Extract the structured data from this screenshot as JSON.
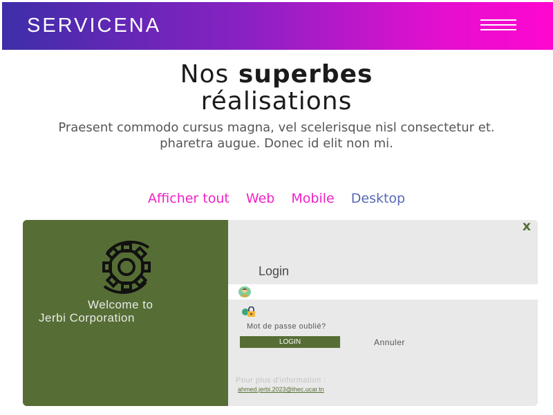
{
  "header": {
    "brand": "SERVICENA",
    "menu_icon": "hamburger-menu-icon"
  },
  "hero": {
    "title_light": "Nos",
    "title_bold": "superbes",
    "title_line2": "réalisations",
    "subtitle_line1": "Praesent commodo cursus magna, vel scelerisque nisl consectetur et.",
    "subtitle_line2": "pharetra augue. Donec id elit non mi."
  },
  "filters": {
    "items": [
      "Afficher tout",
      "Web",
      "Mobile",
      "Desktop"
    ]
  },
  "card": {
    "welcome_line1": "Welcome to",
    "welcome_line2": "Jerbi Corporation",
    "close": "x",
    "login_title": "Login",
    "forgot_password": "Mot de passe oublié?",
    "login_button": "LOGIN",
    "cancel": "Annuler",
    "more_info": "Pour plus d'information :",
    "email": "ahmed.jerbi.2023@ihec.ucar.tn",
    "icons": {
      "gear": "gear-icon",
      "user": "user-avatar-icon",
      "lock": "lock-icon"
    }
  },
  "colors": {
    "gradient_start": "#3e2ea8",
    "gradient_end": "#ff07cf",
    "filter_active": "#f022c5",
    "filter_desktop": "#5868b5",
    "card_green": "#566e35",
    "card_bg": "#e9e9e9"
  }
}
